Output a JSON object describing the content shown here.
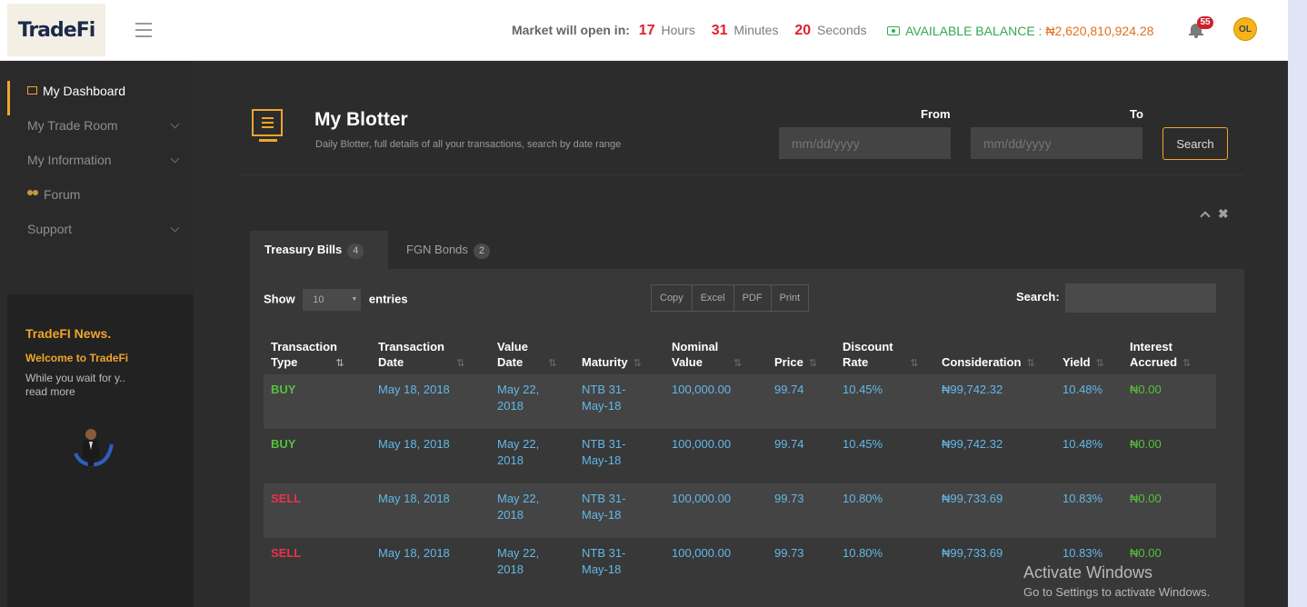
{
  "header": {
    "logo_text": "TradeFi",
    "market_label": "Market will open in:",
    "hours_value": "17",
    "hours_unit": "Hours",
    "minutes_value": "31",
    "minutes_unit": "Minutes",
    "seconds_value": "20",
    "seconds_unit": "Seconds",
    "balance_label": "AVAILABLE BALANCE :",
    "balance_value": "₦2,620,810,924.28",
    "notification_count": "55",
    "avatar_initials": "OL"
  },
  "sidebar": {
    "items": [
      {
        "label": "My Dashboard",
        "active": true
      },
      {
        "label": "My Trade Room",
        "has_submenu": true
      },
      {
        "label": "My Information",
        "has_submenu": true
      },
      {
        "label": "Forum"
      },
      {
        "label": "Support",
        "has_submenu": true
      }
    ],
    "news": {
      "title": "TradeFI News.",
      "headline": "Welcome to TradeFi",
      "body": "While you wait for y..",
      "more": "read more"
    }
  },
  "page": {
    "title": "My Blotter",
    "subtitle": "Daily Blotter, full details of all your transactions, search by date range",
    "from_label": "From",
    "to_label": "To",
    "date_placeholder": "mm/dd/yyyy",
    "search_button": "Search"
  },
  "tabs": [
    {
      "label": "Treasury Bills",
      "count": "4",
      "active": true
    },
    {
      "label": "FGN Bonds",
      "count": "2",
      "active": false
    }
  ],
  "table_controls": {
    "show_label": "Show",
    "entries_value": "10",
    "entries_label": "entries",
    "buttons": [
      "Copy",
      "Excel",
      "PDF",
      "Print"
    ],
    "search_label": "Search:"
  },
  "table": {
    "columns": [
      [
        "Transaction",
        "Type"
      ],
      [
        "Transaction",
        "Date"
      ],
      [
        "Value",
        "Date"
      ],
      [
        "",
        "Maturity"
      ],
      [
        "Nominal",
        "Value"
      ],
      [
        "",
        "Price"
      ],
      [
        "Discount",
        "Rate"
      ],
      [
        "",
        "Consideration"
      ],
      [
        "",
        "Yield"
      ],
      [
        "Interest",
        "Accrued"
      ]
    ],
    "rows": [
      {
        "type": "BUY",
        "trans_date": "May 18, 2018",
        "value_date": [
          "May 22,",
          "2018"
        ],
        "maturity": [
          "NTB 31-",
          "May-18"
        ],
        "nominal": "100,000.00",
        "price": "99.74",
        "rate": "10.45%",
        "consideration": "₦99,742.32",
        "yield": "10.48%",
        "interest": "₦0.00"
      },
      {
        "type": "BUY",
        "trans_date": "May 18, 2018",
        "value_date": [
          "May 22,",
          "2018"
        ],
        "maturity": [
          "NTB 31-",
          "May-18"
        ],
        "nominal": "100,000.00",
        "price": "99.74",
        "rate": "10.45%",
        "consideration": "₦99,742.32",
        "yield": "10.48%",
        "interest": "₦0.00"
      },
      {
        "type": "SELL",
        "trans_date": "May 18, 2018",
        "value_date": [
          "May 22,",
          "2018"
        ],
        "maturity": [
          "NTB 31-",
          "May-18"
        ],
        "nominal": "100,000.00",
        "price": "99.73",
        "rate": "10.80%",
        "consideration": "₦99,733.69",
        "yield": "10.83%",
        "interest": "₦0.00"
      },
      {
        "type": "SELL",
        "trans_date": "May 18, 2018",
        "value_date": [
          "May 22,",
          "2018"
        ],
        "maturity": [
          "NTB 31-",
          "May-18"
        ],
        "nominal": "100,000.00",
        "price": "99.73",
        "rate": "10.80%",
        "consideration": "₦99,733.69",
        "yield": "10.83%",
        "interest": "₦0.00"
      }
    ]
  },
  "watermark": {
    "line1": "Activate Windows",
    "line2": "Go to Settings to activate Windows."
  },
  "colors": {
    "accent": "#f0a52d",
    "buy": "#53c13c",
    "sell": "#e8334a",
    "link_blue": "#62b8e8",
    "countdown": "#e0202e"
  }
}
